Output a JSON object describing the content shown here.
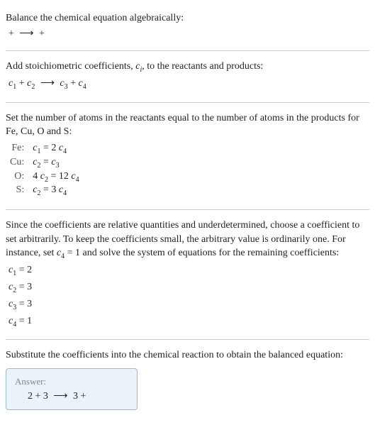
{
  "s1": {
    "heading": "Balance the chemical equation algebraically:",
    "eq_left": " + ",
    "eq_arrow": "⟶",
    "eq_right": " + "
  },
  "s2": {
    "heading": "Add stoichiometric coefficients, ",
    "ci_c": "c",
    "ci_i": "i",
    "heading2": ", to the reactants and products:",
    "c1": "c",
    "c1s": "1",
    "plus1": " + ",
    "c2": "c",
    "c2s": "2",
    "arrow": "⟶",
    "c3": "c",
    "c3s": "3",
    "plus2": " + ",
    "c4": "c",
    "c4s": "4"
  },
  "s3": {
    "heading": "Set the number of atoms in the reactants equal to the number of atoms in the products for Fe, Cu, O and S:",
    "rows": [
      {
        "label": "Fe:",
        "lhs_c": "c",
        "lhs_s": "1",
        "eq": " = 2 ",
        "rhs_c": "c",
        "rhs_s": "4",
        "pre": ""
      },
      {
        "label": "Cu:",
        "lhs_c": "c",
        "lhs_s": "2",
        "eq": " = ",
        "rhs_c": "c",
        "rhs_s": "3",
        "pre": ""
      },
      {
        "label": "O:",
        "lhs_c": "c",
        "lhs_s": "2",
        "eq": " = 12 ",
        "rhs_c": "c",
        "rhs_s": "4",
        "pre": "4 "
      },
      {
        "label": "S:",
        "lhs_c": "c",
        "lhs_s": "2",
        "eq": " = 3 ",
        "rhs_c": "c",
        "rhs_s": "4",
        "pre": ""
      }
    ]
  },
  "s4": {
    "text1": "Since the coefficients are relative quantities and underdetermined, choose a coefficient to set arbitrarily. To keep the coefficients small, the arbitrary value is ordinarily one. For instance, set ",
    "c4c": "c",
    "c4s": "4",
    "eq1": " = 1",
    "text2": " and solve the system of equations for the remaining coefficients:",
    "r1c": "c",
    "r1s": "1",
    "r1v": " = 2",
    "r2c": "c",
    "r2s": "2",
    "r2v": " = 3",
    "r3c": "c",
    "r3s": "3",
    "r3v": " = 3",
    "r4c": "c",
    "r4s": "4",
    "r4v": " = 1"
  },
  "s5": {
    "heading": "Substitute the coefficients into the chemical reaction to obtain the balanced equation:"
  },
  "answer": {
    "title": "Answer:",
    "l1": "2 ",
    "plus1": " + 3 ",
    "arrow": "⟶",
    "l2": " 3 ",
    "plus2": " + "
  }
}
